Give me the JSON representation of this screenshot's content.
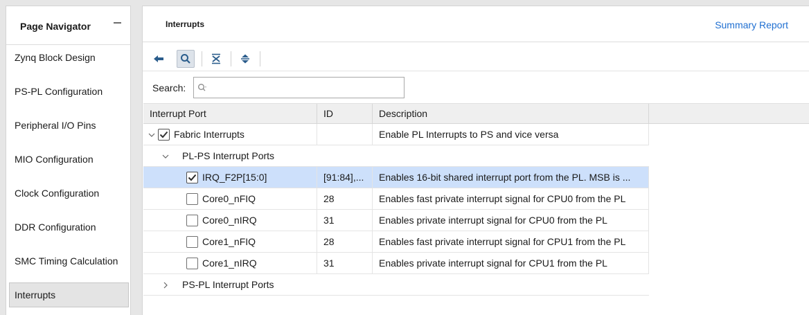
{
  "navigator": {
    "title": "Page Navigator",
    "items": [
      {
        "label": "Zynq Block Design"
      },
      {
        "label": "PS-PL Configuration"
      },
      {
        "label": "Peripheral I/O Pins"
      },
      {
        "label": "MIO Configuration"
      },
      {
        "label": "Clock Configuration"
      },
      {
        "label": "DDR Configuration"
      },
      {
        "label": "SMC Timing Calculation"
      },
      {
        "label": "Interrupts",
        "selected": true
      }
    ]
  },
  "header": {
    "title": "Interrupts",
    "summary_link": "Summary Report"
  },
  "toolbar": {
    "icons": [
      "back-icon",
      "search-icon",
      "collapse-all-icon",
      "expand-all-icon"
    ]
  },
  "search": {
    "label": "Search:",
    "value": "",
    "placeholder": "Q-"
  },
  "table": {
    "columns": [
      "Interrupt Port",
      "ID",
      "Description"
    ],
    "rows": [
      {
        "port": "Fabric Interrupts",
        "id": "",
        "description": "Enable PL Interrupts to PS and vice versa",
        "checked": true,
        "expanded": true
      },
      {
        "port": "PL-PS Interrupt Ports",
        "expanded": true
      },
      {
        "port": "IRQ_F2P[15:0]",
        "id": "[91:84],...",
        "description": "Enables 16-bit shared interrupt port from the PL. MSB is ...",
        "checked": true,
        "selected": true
      },
      {
        "port": "Core0_nFIQ",
        "id": "28",
        "description": "Enables fast private interrupt signal for CPU0 from the PL",
        "checked": false
      },
      {
        "port": "Core0_nIRQ",
        "id": "31",
        "description": "Enables private interrupt signal for CPU0 from the PL",
        "checked": false
      },
      {
        "port": "Core1_nFIQ",
        "id": "28",
        "description": "Enables fast private interrupt signal for CPU1 from the PL",
        "checked": false
      },
      {
        "port": "Core1_nIRQ",
        "id": "31",
        "description": "Enables private interrupt signal for CPU1 from the PL",
        "checked": false
      },
      {
        "port": "PS-PL Interrupt Ports",
        "expanded": false
      }
    ]
  },
  "colors": {
    "selection": "#cde0fb",
    "link": "#1f6fd1",
    "icon_blue": "#2b5d8c"
  }
}
